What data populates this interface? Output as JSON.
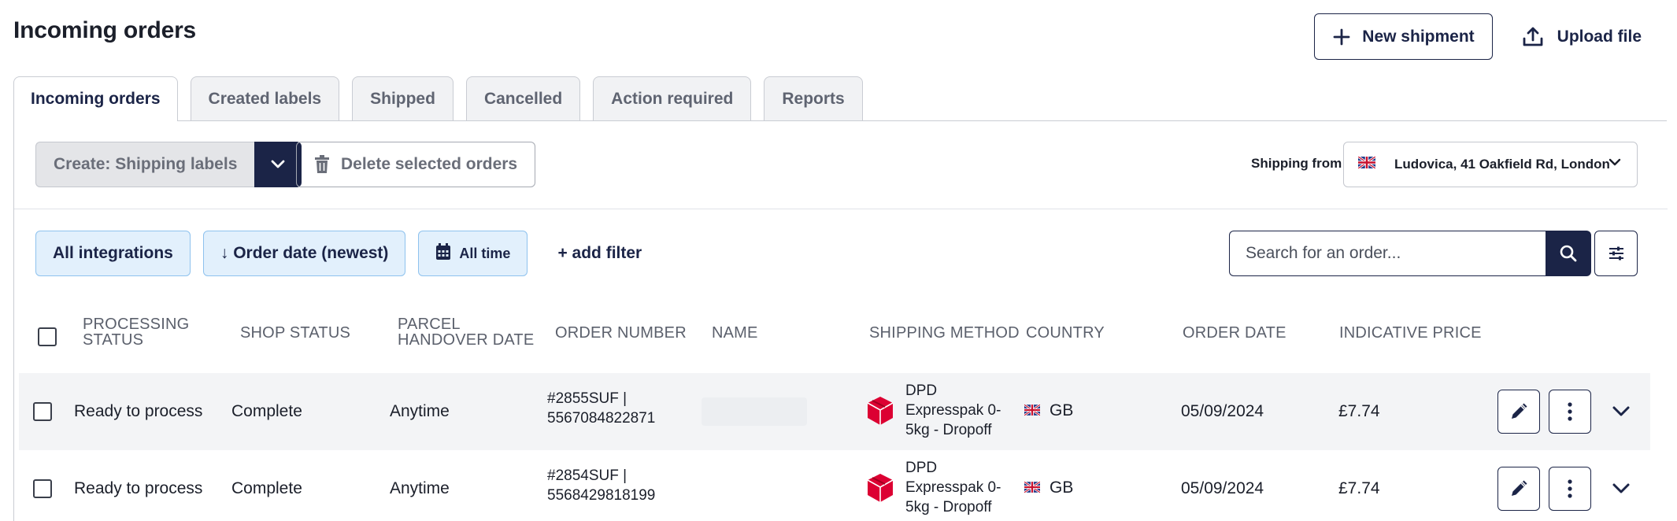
{
  "page": {
    "title": "Incoming orders"
  },
  "top_actions": {
    "new_shipment": "New shipment",
    "upload_file": "Upload file"
  },
  "tabs": [
    {
      "label": "Incoming orders",
      "active": true
    },
    {
      "label": "Created labels",
      "active": false
    },
    {
      "label": "Shipped",
      "active": false
    },
    {
      "label": "Cancelled",
      "active": false
    },
    {
      "label": "Action required",
      "active": false
    },
    {
      "label": "Reports",
      "active": false
    }
  ],
  "toolbar": {
    "create_label": "Create: Shipping labels",
    "delete_label": "Delete selected orders",
    "shipping_from_label": "Shipping from",
    "shipping_from_value": "Ludovica, 41 Oakfield Rd, London"
  },
  "filters": {
    "integrations": "All integrations",
    "order_sort": "↓ Order date (newest)",
    "time": "All time",
    "add_filter": "+ add filter"
  },
  "search": {
    "placeholder": "Search for an order..."
  },
  "table": {
    "headers": {
      "processing_status": "PROCESSING STATUS",
      "shop_status": "SHOP STATUS",
      "handover_date": "PARCEL HANDOVER DATE",
      "order_number": "ORDER NUMBER",
      "name": "NAME",
      "shipping_method": "SHIPPING METHOD",
      "country": "COUNTRY",
      "order_date": "ORDER DATE",
      "indicative_price": "INDICATIVE PRICE"
    },
    "rows": [
      {
        "processing_status": "Ready to process",
        "shop_status": "Complete",
        "handover_date": "Anytime",
        "order_ref": "#2855SUF  |",
        "order_id": "5567084822871",
        "shipping_line1": "DPD",
        "shipping_line2": "Expresspak 0-",
        "shipping_line3": "5kg - Dropoff",
        "country": "GB",
        "order_date": "05/09/2024",
        "price": "£7.74"
      },
      {
        "processing_status": "Ready to process",
        "shop_status": "Complete",
        "handover_date": "Anytime",
        "order_ref": "#2854SUF  |",
        "order_id": "5568429818199",
        "shipping_line1": "DPD",
        "shipping_line2": "Expresspak 0-",
        "shipping_line3": "5kg - Dropoff",
        "country": "GB",
        "order_date": "05/09/2024",
        "price": "£7.74"
      }
    ]
  },
  "colors": {
    "navy": "#1b2447",
    "chip_bg": "#e2f0fc",
    "chip_border": "#8ec2ee",
    "dpd_red": "#dc0032"
  }
}
